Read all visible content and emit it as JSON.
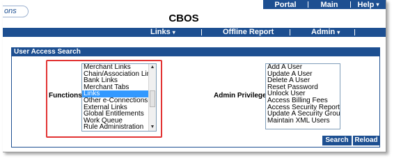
{
  "app": {
    "logo_text": "ons",
    "title": "CBOS"
  },
  "top_menu": {
    "portal": "Portal",
    "main": "Main",
    "help": "Help",
    "help_caret": "▾"
  },
  "main_nav": {
    "links": "Links",
    "offline_report": "Offline Report",
    "admin": "Admin",
    "caret": "▾",
    "separator": "|"
  },
  "panel": {
    "title": "User Access Search",
    "functions_label": "Functions:",
    "admin_label": "Admin Privileges:"
  },
  "functions_list": [
    "Merchant Links",
    "Chain/Association Links",
    "Bank Links",
    "Merchant Tabs",
    "Links",
    "Other e-Connections",
    "External Links",
    "Global Entitlements",
    "Work Queue",
    "Rule Administration"
  ],
  "functions_selected": "Links",
  "admin_list": [
    "Add A User",
    "Update A User",
    "Delete A User",
    "Reset Password",
    "Unlock User",
    "Access Billing Fees",
    "Access Security Report",
    "Update A Security Group",
    "Maintain XML Users"
  ],
  "buttons": {
    "search": "Search",
    "reload": "Reload"
  },
  "colors": {
    "nav_blue": "#1d4f91",
    "selection": "#3399ff",
    "highlight_border": "#e23333"
  }
}
